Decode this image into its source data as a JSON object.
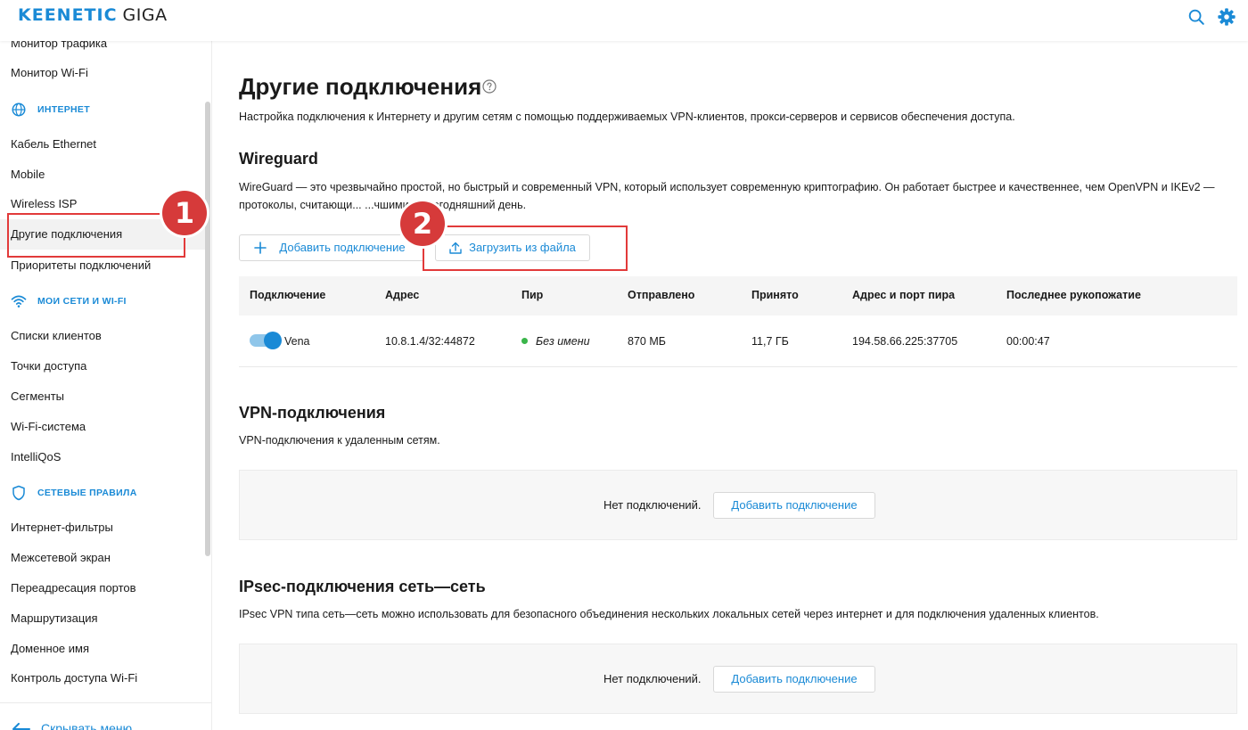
{
  "header": {
    "brand": "KEENETIC",
    "model": "GIGA",
    "search_icon": "search-icon",
    "settings_icon": "gear-icon",
    "accent_color": "#1a8ad6"
  },
  "sidebar": {
    "items_top": [
      "Монитор трафика",
      "Монитор Wi-Fi"
    ],
    "group_internet": "ИНТЕРНЕТ",
    "internet_items": [
      "Кабель Ethernet",
      "Mobile",
      "Wireless ISP",
      "Другие подключения",
      "Приоритеты подключений"
    ],
    "group_networks": "МОИ СЕТИ И WI-FI",
    "network_items": [
      "Списки клиентов",
      "Точки доступа",
      "Сегменты",
      "Wi-Fi-система",
      "IntelliQoS"
    ],
    "group_rules": "СЕТЕВЫЕ ПРАВИЛА",
    "rules_items": [
      "Интернет-фильтры",
      "Межсетевой экран",
      "Переадресация портов",
      "Маршрутизация",
      "Доменное имя",
      "Контроль доступа Wi-Fi"
    ],
    "hide_menu": "Скрывать меню"
  },
  "page": {
    "title": "Другие подключения",
    "description": "Настройка подключения к Интернету и другим сетям с помощью поддерживаемых VPN-клиентов, прокси-серверов и сервисов обеспечения доступа."
  },
  "wireguard": {
    "title": "Wireguard",
    "description": "WireGuard — это чрезвычайно простой, но быстрый и современный VPN, который использует современную криптографию. Он работает быстрее и качественнее, чем OpenVPN и IKEv2 — протоколы, считающи... ...чшими на сегодняшний день.",
    "add_button": "Добавить подключение",
    "upload_button": "Загрузить из файла",
    "columns": [
      "Подключение",
      "Адрес",
      "Пир",
      "Отправлено",
      "Принято",
      "Адрес и порт пира",
      "Последнее рукопожатие"
    ],
    "row": {
      "enabled": true,
      "name": "Vena",
      "address": "10.8.1.4/32:44872",
      "peer": "Без имени",
      "sent": "870 МБ",
      "received": "11,7 ГБ",
      "peer_endpoint": "194.58.66.225:37705",
      "last_handshake": "00:00:47"
    }
  },
  "vpn": {
    "title": "VPN-подключения",
    "description": "VPN-подключения к удаленным сетям.",
    "empty_text": "Нет подключений.",
    "add_button": "Добавить подключение"
  },
  "ipsec": {
    "title": "IPsec-подключения сеть—сеть",
    "description": "IPsec VPN типа сеть—сеть можно использовать для безопасного объединения нескольких локальных сетей через интернет и для подключения удаленных клиентов.",
    "empty_text": "Нет подключений.",
    "add_button": "Добавить подключение"
  },
  "annotations": {
    "badge_1": "1",
    "badge_2": "2",
    "highlight_color": "#e23a3a"
  }
}
